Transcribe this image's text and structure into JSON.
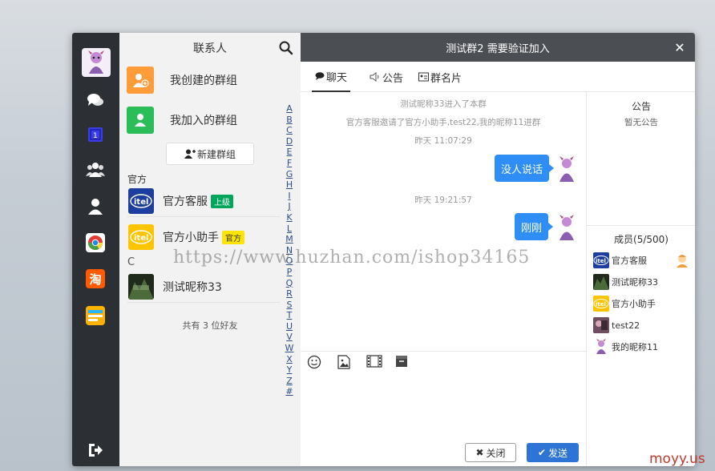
{
  "window": {
    "title": "测试群2 需要验证加入",
    "close_icon": "close-icon"
  },
  "iconbar": {
    "items": [
      "chat-bubbles-icon",
      "address-book-icon",
      "group-icon",
      "user-icon",
      "chrome-app-icon",
      "taobao-app-icon",
      "notes-app-icon"
    ],
    "taobao_label": "淘",
    "logout_icon": "logout-icon"
  },
  "contacts": {
    "title": "联系人",
    "my_created_groups": "我创建的群组",
    "my_joined_groups": "我加入的群组",
    "new_group_button": "新建群组",
    "section_official": "官方",
    "official": [
      {
        "name": "官方客服",
        "tag": "上级"
      },
      {
        "name": "官方小助手",
        "tag": "官方"
      }
    ],
    "section_c": "C",
    "friends_c": [
      {
        "name": "测试昵称33"
      }
    ],
    "friend_count": "共有 3 位好友",
    "alphabet": [
      "A",
      "B",
      "C",
      "D",
      "E",
      "F",
      "G",
      "H",
      "I",
      "J",
      "K",
      "L",
      "M",
      "N",
      "O",
      "P",
      "Q",
      "R",
      "S",
      "T",
      "U",
      "V",
      "W",
      "X",
      "Y",
      "Z",
      "#"
    ]
  },
  "tabs": {
    "chat": "聊天",
    "notice": "公告",
    "card": "群名片"
  },
  "messages": {
    "sys1": "测试昵称33进入了本群",
    "sys2": "官方客服邀请了官方小助手,test22,我的昵称11进群",
    "time1": "昨天 11:07:29",
    "msg1": "没人说话",
    "time2": "昨天 19:21:57",
    "msg2": "刚刚"
  },
  "watermark": "https://www.huzhan.com/ishop34165",
  "toolbar": [
    "emoji-icon",
    "image-icon",
    "video-icon",
    "file-icon"
  ],
  "buttons": {
    "close": "关闭",
    "send": "发送"
  },
  "side": {
    "notice_title": "公告",
    "notice_empty": "暂无公告",
    "members_title": "成员(5/500)",
    "members": [
      {
        "name": "官方客服"
      },
      {
        "name": "测试昵称33"
      },
      {
        "name": "官方小助手"
      },
      {
        "name": "test22"
      },
      {
        "name": "我的昵称11"
      }
    ]
  },
  "corner_mark": "moyy.us",
  "colors": {
    "accent_blue": "#2e8ef5",
    "send_blue": "#2e74d6",
    "dark_bar": "#2c2f33",
    "header_gray": "#4b4e52",
    "tag_green": "#00a65a",
    "tag_yellow": "#ffe400"
  }
}
